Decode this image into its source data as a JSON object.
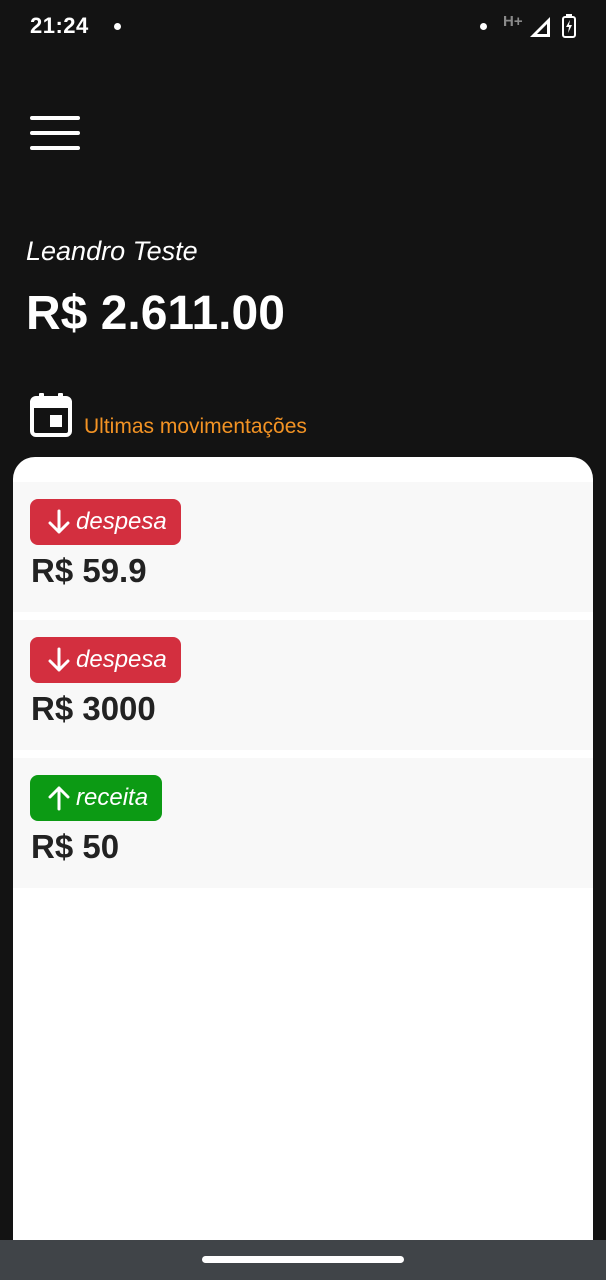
{
  "status_bar": {
    "time": "21:24",
    "network": "H+",
    "icons": [
      "notification-dot-icon",
      "signal-icon",
      "battery-charging-icon"
    ]
  },
  "header": {
    "menu_icon": "hamburger-menu-icon",
    "user_name": "Leandro Teste",
    "balance": "R$ 2.611.00"
  },
  "section": {
    "icon": "calendar-icon",
    "title": "Ultimas movimentações",
    "title_color": "#f39324"
  },
  "transactions": [
    {
      "type_label": "despesa",
      "direction": "down",
      "amount": "R$ 59.9",
      "badge_color": "#d32f3f",
      "icon": "arrow-down-icon"
    },
    {
      "type_label": "despesa",
      "direction": "down",
      "amount": "R$ 3000",
      "badge_color": "#d32f3f",
      "icon": "arrow-down-icon"
    },
    {
      "type_label": "receita",
      "direction": "up",
      "amount": "R$ 50",
      "badge_color": "#0c9a14",
      "icon": "arrow-up-icon"
    }
  ],
  "colors": {
    "background": "#131313",
    "card": "#ffffff",
    "item": "#f8f8f8",
    "nav_bar": "#404448"
  }
}
